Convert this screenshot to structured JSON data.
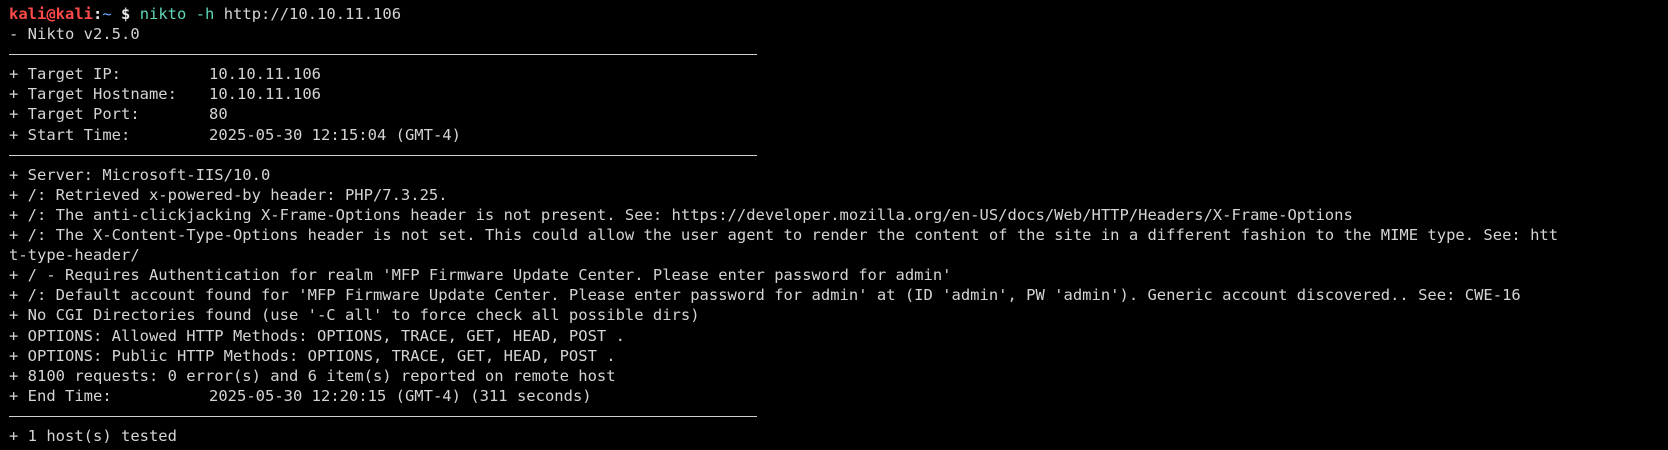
{
  "prompt": {
    "user_host": "kali@kali",
    "separator": ":",
    "path": "~",
    "symbol": " $ ",
    "command": "nikto",
    "flag": "-h",
    "target": "http://10.10.11.106"
  },
  "version_line": "- Nikto v2.5.0",
  "target_info": [
    {
      "key": "+ Target IP:",
      "value": "10.10.11.106"
    },
    {
      "key": "+ Target Hostname:",
      "value": "10.10.11.106"
    },
    {
      "key": "+ Target Port:",
      "value": "80"
    },
    {
      "key": "+ Start Time:",
      "value": "2025-05-30 12:15:04 (GMT-4)"
    }
  ],
  "findings": [
    "+ Server: Microsoft-IIS/10.0",
    "+ /: Retrieved x-powered-by header: PHP/7.3.25.",
    "+ /: The anti-clickjacking X-Frame-Options header is not present. See: https://developer.mozilla.org/en-US/docs/Web/HTTP/Headers/X-Frame-Options",
    "+ /: The X-Content-Type-Options header is not set. This could allow the user agent to render the content of the site in a different fashion to the MIME type. See: htt",
    "t-type-header/",
    "+ / - Requires Authentication for realm 'MFP Firmware Update Center. Please enter password for admin'",
    "+ /: Default account found for 'MFP Firmware Update Center. Please enter password for admin' at (ID 'admin', PW 'admin'). Generic account discovered.. See: CWE-16",
    "+ No CGI Directories found (use '-C all' to force check all possible dirs)",
    "+ OPTIONS: Allowed HTTP Methods: OPTIONS, TRACE, GET, HEAD, POST .",
    "+ OPTIONS: Public HTTP Methods: OPTIONS, TRACE, GET, HEAD, POST .",
    "+ 8100 requests: 0 error(s) and 6 item(s) reported on remote host"
  ],
  "end_time": {
    "key": "+ End Time:",
    "value": "2025-05-30 12:20:15 (GMT-4) (311 seconds)"
  },
  "summary": "+ 1 host(s) tested",
  "colors": {
    "background": "#000000",
    "text": "#d4d4d4",
    "prompt_user": "#ff4a4a",
    "prompt_path": "#6ea8ff",
    "command": "#5fd7b8"
  }
}
